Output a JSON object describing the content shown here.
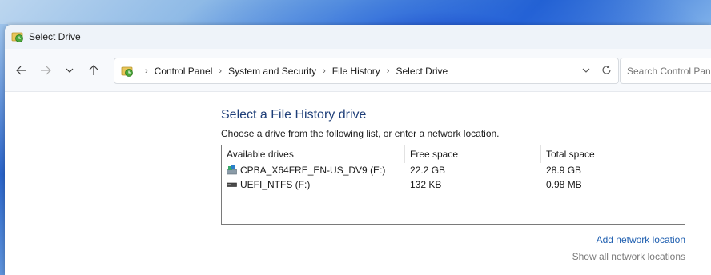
{
  "window": {
    "title": "Select Drive"
  },
  "nav": {
    "back_icon": "arrow-left-icon",
    "forward_icon": "arrow-right-icon",
    "recent_icon": "chevron-down-icon",
    "up_icon": "arrow-up-icon"
  },
  "address": {
    "breadcrumbs": [
      "Control Panel",
      "System and Security",
      "File History",
      "Select Drive"
    ],
    "dropdown_icon": "chevron-down-icon",
    "refresh_icon": "refresh-icon"
  },
  "search": {
    "placeholder": "Search Control Panel"
  },
  "main": {
    "heading": "Select a File History drive",
    "instruction": "Choose a drive from the following list, or enter a network location.",
    "columns": [
      "Available drives",
      "Free space",
      "Total space"
    ],
    "drives": [
      {
        "name": "CPBA_X64FRE_EN-US_DV9 (E:)",
        "free": "22.2 GB",
        "total": "28.9 GB",
        "icon": "optical-drive-icon"
      },
      {
        "name": "UEFI_NTFS (F:)",
        "free": "132 KB",
        "total": "0.98 MB",
        "icon": "removable-drive-icon"
      }
    ],
    "add_network_location": "Add network location",
    "show_all_network_locations": "Show all network locations"
  },
  "colors": {
    "heading": "#1e3e78",
    "link": "#1f5fb0",
    "link_disabled": "#7a7a7a"
  }
}
